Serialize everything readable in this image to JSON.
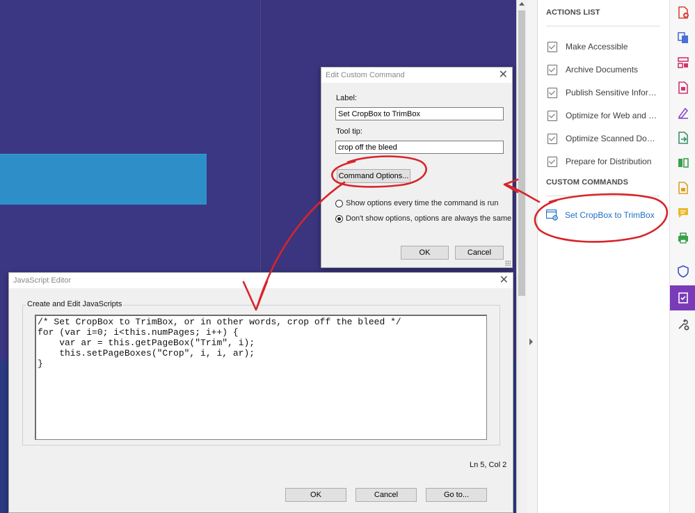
{
  "actions_panel": {
    "actions_heading": "ACTIONS LIST",
    "actions": [
      {
        "label": "Make Accessible"
      },
      {
        "label": "Archive Documents"
      },
      {
        "label": "Publish Sensitive Inform..."
      },
      {
        "label": "Optimize for Web and M..."
      },
      {
        "label": "Optimize Scanned Docu..."
      },
      {
        "label": "Prepare for Distribution"
      }
    ],
    "custom_heading": "CUSTOM COMMANDS",
    "custom_command": {
      "label": "Set CropBox to TrimBox",
      "color": "#1f6fc4"
    }
  },
  "edit_dialog": {
    "title": "Edit Custom Command",
    "label_caption": "Label:",
    "label_value": "Set CropBox to TrimBox",
    "tooltip_caption": "Tool tip:",
    "tooltip_value": "crop off the bleed",
    "command_options_button": "Command Options...",
    "radio_options": [
      {
        "label": "Show options every time the command is run",
        "selected": false
      },
      {
        "label": "Don't show options, options are always the same",
        "selected": true
      }
    ],
    "ok_button": "OK",
    "cancel_button": "Cancel"
  },
  "js_editor": {
    "title": "JavaScript Editor",
    "group_label": "Create and Edit JavaScripts",
    "code": "/* Set CropBox to TrimBox, or in other words, crop off the bleed */\nfor (var i=0; i<this.numPages; i++) {\n    var ar = this.getPageBox(\"Trim\", i);\n    this.setPageBoxes(\"Crop\", i, i, ar);\n}",
    "cursor_status": "Ln 5, Col 2",
    "ok_button": "OK",
    "cancel_button": "Cancel",
    "goto_button": "Go to..."
  },
  "close_glyph": "✕",
  "tool_rail": {
    "active_color": "#7a3bb8",
    "tools": [
      {
        "icon": "create-pdf-icon",
        "color": "#e0423a"
      },
      {
        "icon": "combine-files-icon",
        "color": "#4a6fd8"
      },
      {
        "icon": "organize-pages-icon",
        "color": "#d0346f"
      },
      {
        "icon": "edit-pdf-icon",
        "color": "#d0346f"
      },
      {
        "icon": "fill-sign-icon",
        "color": "#8a4fc8"
      },
      {
        "icon": "export-pdf-icon",
        "color": "#3a8f6a"
      },
      {
        "icon": "compare-files-icon",
        "color": "#3aa04a"
      },
      {
        "icon": "scan-ocr-icon",
        "color": "#e0a020"
      },
      {
        "icon": "comment-icon",
        "color": "#e8b92a"
      },
      {
        "icon": "print-production-icon",
        "color": "#3aa04a"
      },
      {
        "icon": "protect-icon",
        "color": "#3a4fc8"
      },
      {
        "icon": "action-wizard-icon",
        "color": "#ffffff"
      },
      {
        "icon": "more-tools-icon",
        "color": "#555555"
      }
    ]
  },
  "annotation_color": "#d8242a"
}
